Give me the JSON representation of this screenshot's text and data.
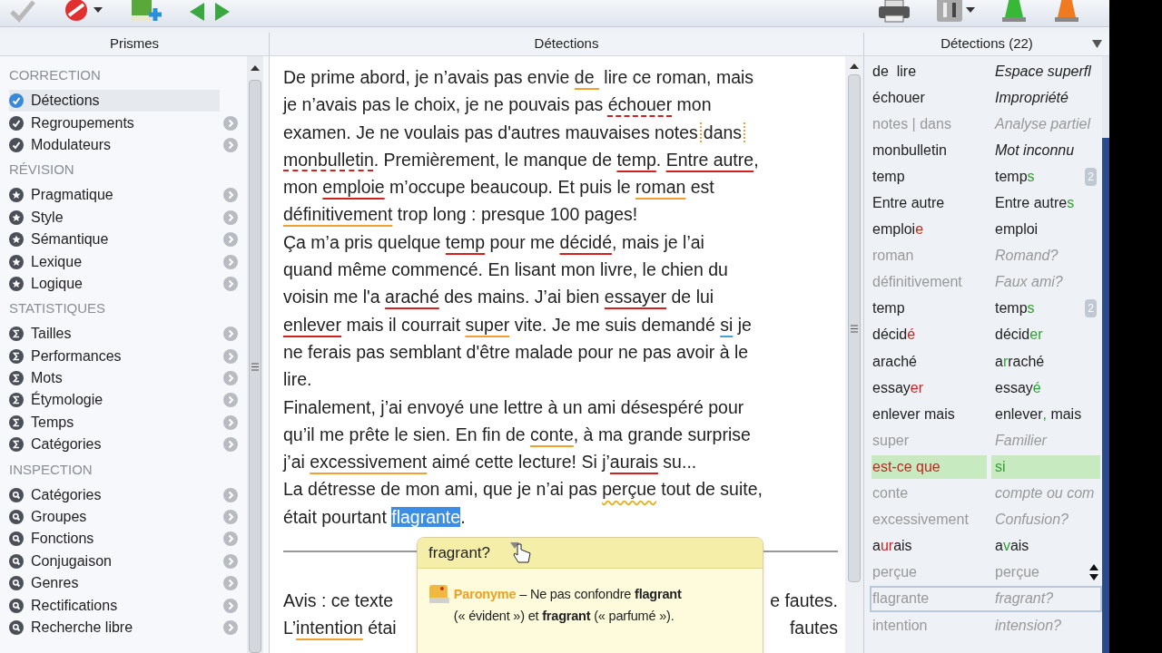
{
  "toolbar": {
    "left": [
      {
        "kind": "check"
      },
      {
        "kind": "stop",
        "caret": true
      },
      {
        "kind": "book-add"
      },
      {
        "kind": "arrows"
      }
    ],
    "right": [
      {
        "kind": "printer"
      },
      {
        "kind": "tool",
        "caret": true
      },
      {
        "kind": "cone-green"
      },
      {
        "kind": "cone-orange"
      }
    ]
  },
  "sidebar": {
    "title": "Prismes",
    "sections": [
      {
        "title": "CORRECTION",
        "kind": "check",
        "items": [
          {
            "label": "Détections",
            "selected": true
          },
          {
            "label": "Regroupements",
            "selected": false
          },
          {
            "label": "Modulateurs",
            "selected": false
          }
        ]
      },
      {
        "title": "RÉVISION",
        "kind": "star",
        "items": [
          {
            "label": "Pragmatique",
            "selected": false
          },
          {
            "label": "Style",
            "selected": false
          },
          {
            "label": "Sémantique",
            "selected": false
          },
          {
            "label": "Lexique",
            "selected": false
          },
          {
            "label": "Logique",
            "selected": false
          }
        ]
      },
      {
        "title": "STATISTIQUES",
        "kind": "sigma",
        "items": [
          {
            "label": "Tailles",
            "selected": false
          },
          {
            "label": "Performances",
            "selected": false
          },
          {
            "label": "Mots",
            "selected": false
          },
          {
            "label": "Étymologie",
            "selected": false
          },
          {
            "label": "Temps",
            "selected": false
          },
          {
            "label": "Catégories",
            "selected": false
          }
        ]
      },
      {
        "title": "INSPECTION",
        "kind": "search",
        "items": [
          {
            "label": "Catégories",
            "selected": false
          },
          {
            "label": "Groupes",
            "selected": false
          },
          {
            "label": "Fonctions",
            "selected": false
          },
          {
            "label": "Conjugaison",
            "selected": false
          },
          {
            "label": "Genres",
            "selected": false
          },
          {
            "label": "Rectifications",
            "selected": false
          },
          {
            "label": "Recherche libre",
            "selected": false
          }
        ]
      }
    ]
  },
  "document": {
    "title": "Détections",
    "lines": [
      [
        {
          "t": "De prime abord, je n’avais pas envie "
        },
        {
          "t": "de ",
          "kind": "style"
        },
        {
          "t": " lire ce roman, mais"
        }
      ],
      [
        {
          "t": "je n’avais pas le choix, je ne pouvais pas "
        },
        {
          "t": "échouer",
          "kind": "unknown"
        },
        {
          "t": " mon"
        }
      ],
      [
        {
          "t": "examen. Je ne voulais pas d'autres mauvaises notes"
        },
        {
          "t": "dans",
          "kind": "split"
        }
      ],
      [
        {
          "t": "monbulletin",
          "kind": "unknown"
        },
        {
          "t": ". Premièrement, le manque de "
        },
        {
          "t": "temp",
          "kind": "error"
        },
        {
          "t": ". "
        },
        {
          "t": "Entre autre",
          "kind": "error"
        },
        {
          "t": ","
        }
      ],
      [
        {
          "t": "mon "
        },
        {
          "t": "emploie",
          "kind": "error"
        },
        {
          "t": " m’occupe beaucoup. Et puis le "
        },
        {
          "t": "roman",
          "kind": "style"
        },
        {
          "t": " est"
        }
      ],
      [
        {
          "t": "définitivement",
          "kind": "style"
        },
        {
          "t": " trop long : presque 100 pages!"
        }
      ],
      [
        {
          "t": "Ça m’a pris quelque "
        },
        {
          "t": "temp",
          "kind": "error"
        },
        {
          "t": " pour me "
        },
        {
          "t": "décidé",
          "kind": "error"
        },
        {
          "t": ", mais je l’ai"
        }
      ],
      [
        {
          "t": "quand même commencé. En lisant mon livre, le chien du"
        }
      ],
      [
        {
          "t": "voisin me l'a "
        },
        {
          "t": "araché",
          "kind": "error"
        },
        {
          "t": " des mains. J’ai bien "
        },
        {
          "t": "essayer",
          "kind": "error"
        },
        {
          "t": " de lui"
        }
      ],
      [
        {
          "t": "enlever",
          "kind": "error"
        },
        {
          "t": " mais il courrait "
        },
        {
          "t": "super",
          "kind": "style"
        },
        {
          "t": " vite. Je me suis demandé "
        },
        {
          "t": "si",
          "kind": "info"
        },
        {
          "t": " je"
        }
      ],
      [
        {
          "t": "ne ferais pas semblant d'être malade pour ne pas avoir à le"
        }
      ],
      [
        {
          "t": "lire."
        }
      ],
      [
        {
          "t": "Finalement, j’ai envoyé une lettre à un ami désespéré pour"
        }
      ],
      [
        {
          "t": "qu’il me prête le sien. En fin de "
        },
        {
          "t": "conte",
          "kind": "style"
        },
        {
          "t": ", à ma grande surprise"
        }
      ],
      [
        {
          "t": "j’ai "
        },
        {
          "t": "excessivement",
          "kind": "style"
        },
        {
          "t": " aimé cette lecture! Si j’"
        },
        {
          "t": "aurais",
          "kind": "error"
        },
        {
          "t": " su..."
        }
      ],
      [
        {
          "t": "La détresse de mon ami, que je n’ai pas "
        },
        {
          "t": "perçue",
          "kind": "doubt"
        },
        {
          "t": " tout de suite,"
        }
      ],
      [
        {
          "t": "était pourtant "
        },
        {
          "t": "flagrante",
          "kind": "selected"
        },
        {
          "t": "."
        }
      ]
    ],
    "notice_lines": [
      {
        "left": [
          {
            "t": "Avis : ce texte"
          }
        ],
        "right": [
          {
            "t": "e fautes."
          }
        ]
      },
      {
        "left": [
          {
            "t": "L’"
          },
          {
            "t": "intention",
            "kind": "style"
          },
          {
            "t": " étai"
          }
        ],
        "right": [
          {
            "t": "fautes"
          }
        ]
      }
    ],
    "tooltip": {
      "title": "fragrant?",
      "category": "Paronyme",
      "text": " – Ne pas confondre **flagrant** (« évident ») et **fragrant** (« parfumé »)."
    }
  },
  "detections": {
    "title": "Détections (22)",
    "rows": [
      {
        "kind": "note",
        "dim": false,
        "selected": false,
        "highlighted": false,
        "before": [
          {
            "t": "de  lire"
          }
        ],
        "after": [
          {
            "t": "Espace superfl"
          }
        ]
      },
      {
        "kind": "note",
        "dim": false,
        "selected": false,
        "highlighted": false,
        "before": [
          {
            "t": "échouer"
          }
        ],
        "after": [
          {
            "t": "Impropriété"
          }
        ]
      },
      {
        "kind": "note",
        "dim": true,
        "selected": false,
        "highlighted": false,
        "before": [
          {
            "t": "notes | dans"
          }
        ],
        "after": [
          {
            "t": "Analyse partiel"
          }
        ]
      },
      {
        "kind": "note",
        "dim": false,
        "selected": false,
        "highlighted": false,
        "before": [
          {
            "t": "monbulletin"
          }
        ],
        "after": [
          {
            "t": "Mot inconnu"
          }
        ]
      },
      {
        "kind": "correction",
        "dim": false,
        "selected": false,
        "highlighted": false,
        "before": [
          {
            "t": "temp"
          }
        ],
        "after": [
          {
            "t": "temp"
          },
          {
            "t": "s",
            "diff": true
          }
        ],
        "badge": "2"
      },
      {
        "kind": "correction",
        "dim": false,
        "selected": false,
        "highlighted": false,
        "before": [
          {
            "t": "Entre autre"
          }
        ],
        "after": [
          {
            "t": "Entre autre"
          },
          {
            "t": "s",
            "diff": true
          }
        ]
      },
      {
        "kind": "correction",
        "dim": false,
        "selected": false,
        "highlighted": false,
        "before": [
          {
            "t": "emploi"
          },
          {
            "t": "e",
            "diff": true
          }
        ],
        "after": [
          {
            "t": "emploi"
          }
        ]
      },
      {
        "kind": "note",
        "dim": true,
        "selected": false,
        "highlighted": false,
        "before": [
          {
            "t": "roman"
          }
        ],
        "after": [
          {
            "t": "Romand?"
          }
        ]
      },
      {
        "kind": "note",
        "dim": true,
        "selected": false,
        "highlighted": false,
        "before": [
          {
            "t": "définitivement"
          }
        ],
        "after": [
          {
            "t": "Faux ami?"
          }
        ]
      },
      {
        "kind": "correction",
        "dim": false,
        "selected": false,
        "highlighted": false,
        "before": [
          {
            "t": "temp"
          }
        ],
        "after": [
          {
            "t": "temp"
          },
          {
            "t": "s",
            "diff": true
          }
        ],
        "badge": "2"
      },
      {
        "kind": "correction",
        "dim": false,
        "selected": false,
        "highlighted": false,
        "before": [
          {
            "t": "décid"
          },
          {
            "t": "é",
            "diff": true
          }
        ],
        "after": [
          {
            "t": "décid"
          },
          {
            "t": "er",
            "diff": true
          }
        ]
      },
      {
        "kind": "correction",
        "dim": false,
        "selected": false,
        "highlighted": false,
        "before": [
          {
            "t": "araché"
          }
        ],
        "after": [
          {
            "t": "a"
          },
          {
            "t": "r",
            "diff": true
          },
          {
            "t": "raché"
          }
        ]
      },
      {
        "kind": "correction",
        "dim": false,
        "selected": false,
        "highlighted": false,
        "before": [
          {
            "t": "essay"
          },
          {
            "t": "er",
            "diff": true
          }
        ],
        "after": [
          {
            "t": "essay"
          },
          {
            "t": "é",
            "diff": true
          }
        ]
      },
      {
        "kind": "correction",
        "dim": false,
        "selected": false,
        "highlighted": false,
        "before": [
          {
            "t": "enlever mais"
          }
        ],
        "after": [
          {
            "t": "enlever"
          },
          {
            "t": ",",
            "diff": true
          },
          {
            "t": " mais"
          }
        ]
      },
      {
        "kind": "note",
        "dim": true,
        "selected": false,
        "highlighted": false,
        "before": [
          {
            "t": "super"
          }
        ],
        "after": [
          {
            "t": "Familier"
          }
        ]
      },
      {
        "kind": "correction",
        "dim": false,
        "selected": false,
        "highlighted": true,
        "before": [
          {
            "t": "est-ce que",
            "diff": true
          }
        ],
        "after": [
          {
            "t": "si",
            "diff": true
          }
        ]
      },
      {
        "kind": "note",
        "dim": true,
        "selected": false,
        "highlighted": false,
        "before": [
          {
            "t": "conte"
          }
        ],
        "after": [
          {
            "t": "compte ou com"
          }
        ]
      },
      {
        "kind": "note",
        "dim": true,
        "selected": false,
        "highlighted": false,
        "before": [
          {
            "t": "excessivement"
          }
        ],
        "after": [
          {
            "t": "Confusion?"
          }
        ]
      },
      {
        "kind": "correction",
        "dim": false,
        "selected": false,
        "highlighted": false,
        "before": [
          {
            "t": "a"
          },
          {
            "t": "ur",
            "diff": true
          },
          {
            "t": "ais"
          }
        ],
        "after": [
          {
            "t": "a"
          },
          {
            "t": "v",
            "diff": true
          },
          {
            "t": "ais"
          }
        ]
      },
      {
        "kind": "correction",
        "dim": true,
        "selected": false,
        "highlighted": false,
        "before": [
          {
            "t": "perçue"
          }
        ],
        "after": [
          {
            "t": "perçue"
          }
        ]
      },
      {
        "kind": "note",
        "dim": true,
        "selected": true,
        "highlighted": false,
        "before": [
          {
            "t": "flagrante"
          }
        ],
        "after": [
          {
            "t": "fragrant?"
          }
        ]
      },
      {
        "kind": "note",
        "dim": true,
        "selected": false,
        "highlighted": false,
        "before": [
          {
            "t": "intention"
          }
        ],
        "after": [
          {
            "t": "intension?"
          }
        ]
      }
    ]
  }
}
